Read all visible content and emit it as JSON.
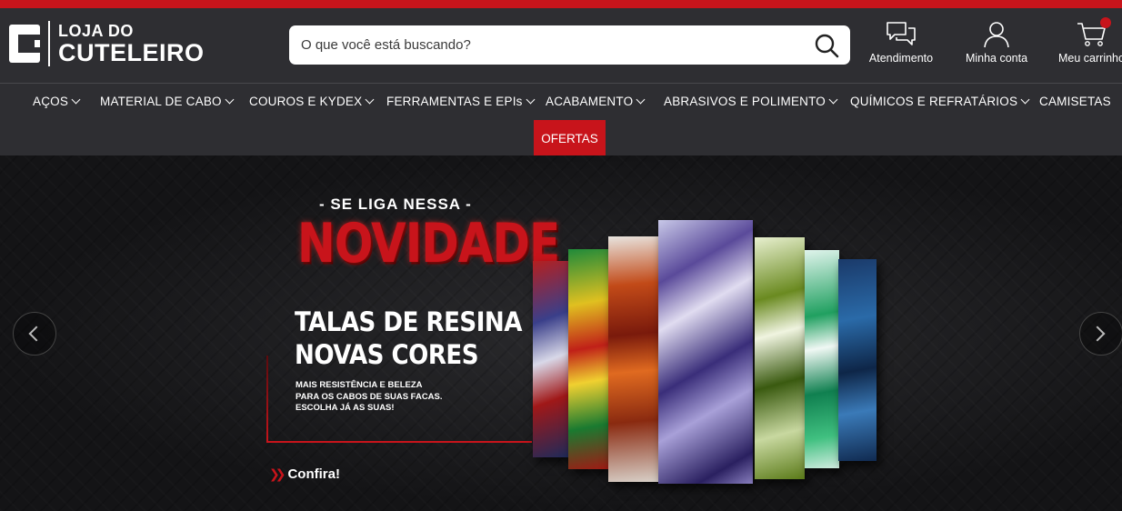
{
  "brand": {
    "line1": "LOJA DO",
    "line2": "CUTELEIRO"
  },
  "search": {
    "placeholder": "O que você está buscando?"
  },
  "header_actions": [
    {
      "label": "Atendimento",
      "icon": "chat-icon"
    },
    {
      "label": "Minha conta",
      "icon": "user-icon"
    },
    {
      "label": "Meu carrinho",
      "icon": "cart-icon"
    }
  ],
  "nav": {
    "items": [
      {
        "label": "AÇOS"
      },
      {
        "label": "MATERIAL DE CABO"
      },
      {
        "label": "COUROS E KYDEX"
      },
      {
        "label": "FERRAMENTAS E EPIs"
      },
      {
        "label": "ACABAMENTO"
      },
      {
        "label": "ABRASIVOS E POLIMENTO"
      },
      {
        "label": "QUÍMICOS E REFRATÁRIOS"
      },
      {
        "label": "CAMISETAS"
      }
    ],
    "highlight": "OFERTAS"
  },
  "banner": {
    "kicker": "- SE LIGA NESSA -",
    "headline": "NOVIDADE",
    "title_line1": "TALAS DE RESINA",
    "title_line2": "NOVAS CORES",
    "sub_line1": "MAIS RESISTÊNCIA E BELEZA",
    "sub_line2": "PARA OS CABOS DE SUAS FACAS.",
    "sub_line3": "ESCOLHA JÁ AS SUAS!",
    "cta": "Confira!"
  },
  "colors": {
    "brand_red": "#c8141b",
    "header_bg": "#2e2e32"
  }
}
